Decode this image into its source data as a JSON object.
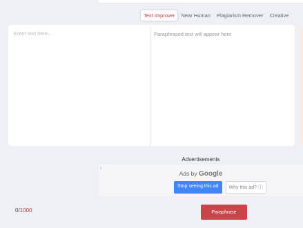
{
  "tabs": [
    {
      "label": "Text Improver",
      "active": true
    },
    {
      "label": "Near Human",
      "active": false
    },
    {
      "label": "Plagiarism Remover",
      "active": false
    },
    {
      "label": "Creative",
      "active": false
    }
  ],
  "input": {
    "placeholder": "Enter text here...",
    "value": ""
  },
  "output": {
    "placeholder": "Paraphrased text will appear here"
  },
  "ads": {
    "title": "Advertisements",
    "back_glyph": "‹",
    "ads_by": "Ads by",
    "provider": "Google",
    "stop_label": "Stop seeing this ad",
    "why_label": "Why this ad? ⓘ"
  },
  "counter": {
    "current": "0",
    "separator": "/",
    "max": "1000"
  },
  "paraphrase_label": "Paraphrase",
  "colors": {
    "accent": "#c9454a",
    "active_tab_text": "#c43c3c",
    "ad_button": "#4285f4",
    "background": "#eef0f5"
  }
}
